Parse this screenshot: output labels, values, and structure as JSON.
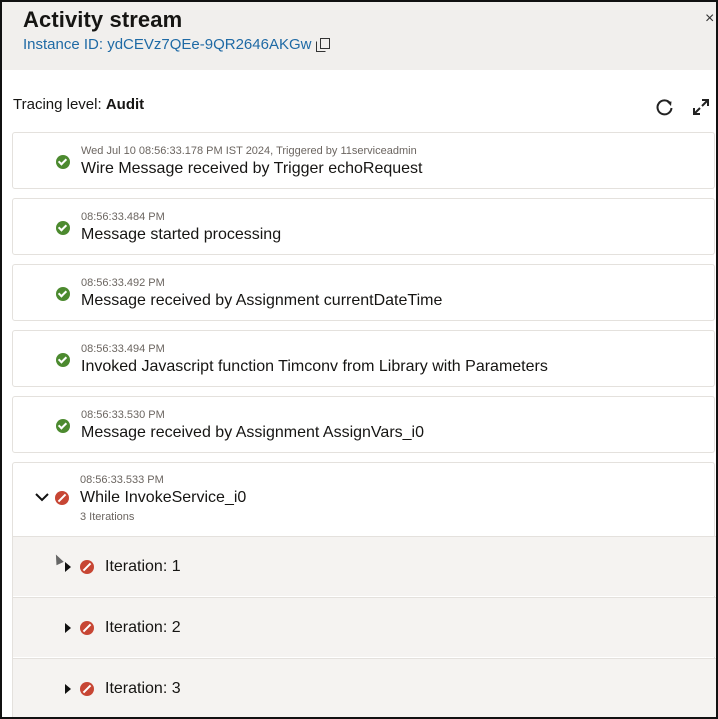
{
  "panel": {
    "title": "Activity stream",
    "instance_label": "Instance ID: ydCEVz7QEe-9QR2646AKGw",
    "close_glyph": "×"
  },
  "tracing": {
    "label": "Tracing level:",
    "value": "Audit"
  },
  "events": [
    {
      "timestamp": "Wed Jul 10 08:56:33.178 PM IST 2024, Triggered by 11serviceadmin",
      "message": "Wire Message received by Trigger echoRequest",
      "status": "success"
    },
    {
      "timestamp": "08:56:33.484 PM",
      "message": "Message started processing",
      "status": "success"
    },
    {
      "timestamp": "08:56:33.492 PM",
      "message": "Message received by Assignment currentDateTime",
      "status": "success"
    },
    {
      "timestamp": "08:56:33.494 PM",
      "message": "Invoked Javascript function Timconv from Library with Parameters",
      "status": "success"
    },
    {
      "timestamp": "08:56:33.530 PM",
      "message": "Message received by Assignment AssignVars_i0",
      "status": "success"
    }
  ],
  "while_block": {
    "timestamp": "08:56:33.533 PM",
    "message": "While InvokeService_i0",
    "sub": "3 Iterations",
    "status": "error",
    "iterations": [
      {
        "label": "Iteration: 1",
        "status": "error"
      },
      {
        "label": "Iteration: 2",
        "status": "error"
      },
      {
        "label": "Iteration: 3",
        "status": "error"
      }
    ]
  },
  "colors": {
    "success": "#4c8a2f",
    "error": "#c74634",
    "link": "#1f6aa5",
    "header_bg": "#f1efed"
  },
  "icons": [
    "copy-icon",
    "close-icon",
    "refresh-icon",
    "expand-icon",
    "success-check-icon",
    "error-icon",
    "chevron-down-icon",
    "caret-right-icon"
  ]
}
